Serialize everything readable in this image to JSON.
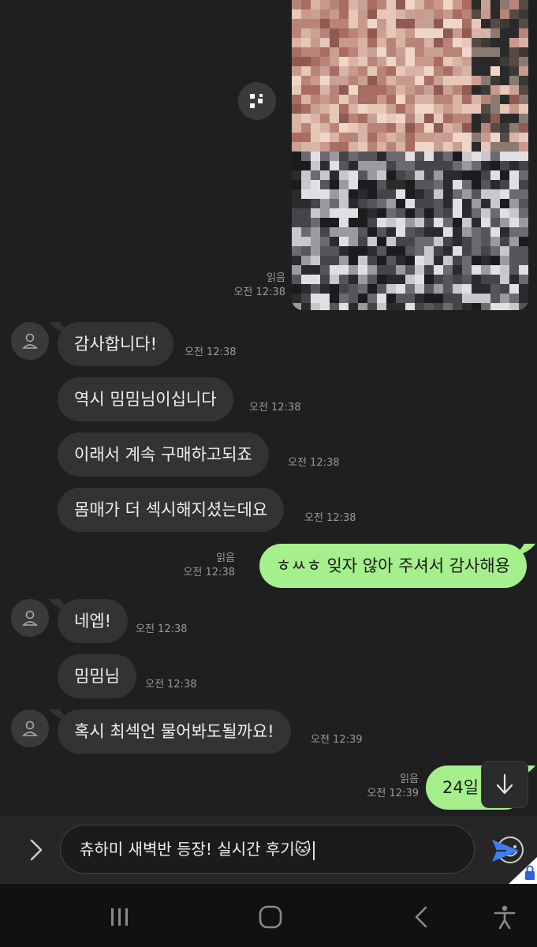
{
  "colors": {
    "background": "#1f1f1f",
    "incoming_bubble": "#333333",
    "outgoing_bubble": "#a5ef8c",
    "meta_text": "#9a9a9a",
    "send_accent": "#3d7bf7"
  },
  "photo_message": {
    "read_label": "읽음",
    "time": "오전 12:38",
    "share_icon": "share-icon"
  },
  "messages": [
    {
      "side": "in",
      "avatar": true,
      "text": "감사합니다!",
      "time": "오전 12:38"
    },
    {
      "side": "in",
      "avatar": false,
      "text": "역시 밈밈님이십니다",
      "time": "오전 12:38"
    },
    {
      "side": "in",
      "avatar": false,
      "text": "이래서 계속 구매하고되죠",
      "time": "오전 12:38"
    },
    {
      "side": "in",
      "avatar": false,
      "text": "몸매가 더 섹시해지셨는데요",
      "time": "오전 12:38"
    },
    {
      "side": "out",
      "read_label": "읽음",
      "text": "ㅎㅆㅎ 잊자 않아 주셔서 감사해용",
      "time": "오전 12:38"
    },
    {
      "side": "in",
      "avatar": true,
      "text": "네엡!",
      "time": "오전 12:38"
    },
    {
      "side": "in",
      "avatar": false,
      "text": "밈밈님",
      "time": "오전 12:38"
    },
    {
      "side": "in",
      "avatar": true,
      "text": "혹시 최섹언 물어봐도될까요!",
      "time": "오전 12:39"
    },
    {
      "side": "out",
      "read_label": "읽음",
      "text": "24일",
      "time": "오전 12:39"
    }
  ],
  "input": {
    "value": "츄하미 새벽반 등장! 실시간 후기🐱"
  },
  "icons": {
    "expand": "chevron-right-icon",
    "emoji": "smiley-icon",
    "send": "send-icon",
    "scroll_down": "arrow-down-icon",
    "lock": "lock-icon",
    "nav_recent": "recent-apps-icon",
    "nav_home": "home-icon",
    "nav_back": "back-icon",
    "nav_accessibility": "accessibility-icon"
  }
}
